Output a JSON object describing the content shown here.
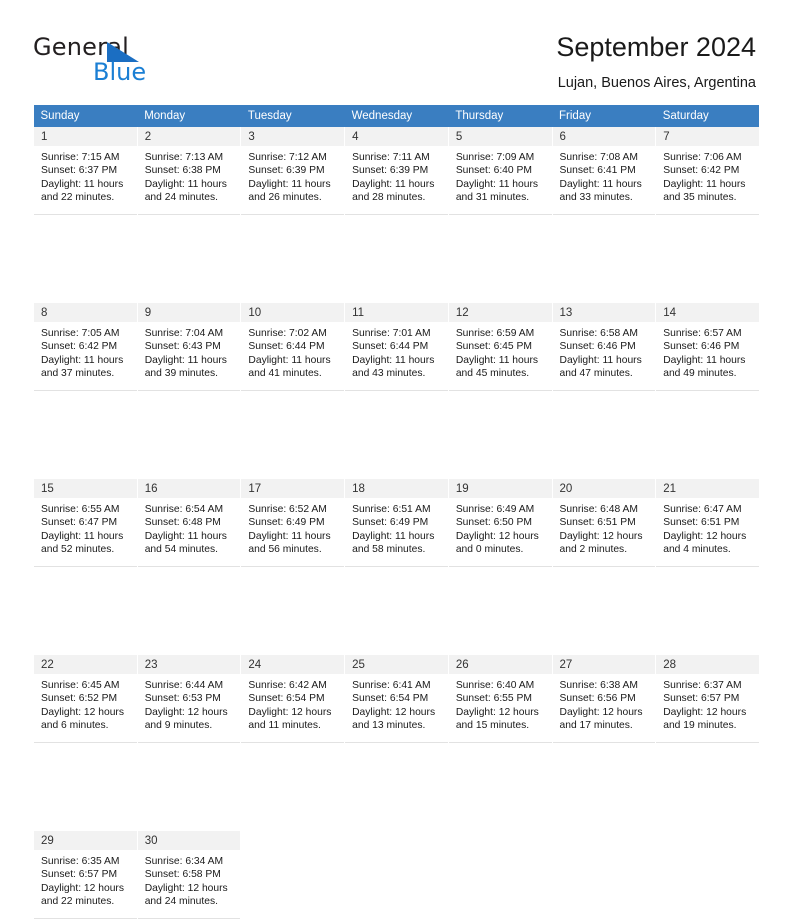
{
  "brand": {
    "name_top": "General",
    "name_bottom": "Blue",
    "accent_color": "#1b7fd4",
    "triangle_color": "#1b6ec2"
  },
  "header": {
    "title": "September 2024",
    "subtitle": "Lujan, Buenos Aires, Argentina",
    "header_bg": "#3a7ec1",
    "header_text_color": "#ffffff"
  },
  "calendar": {
    "weekday_headers": [
      "Sunday",
      "Monday",
      "Tuesday",
      "Wednesday",
      "Thursday",
      "Friday",
      "Saturday"
    ],
    "weeks": [
      [
        {
          "day": "1",
          "sunrise": "Sunrise: 7:15 AM",
          "sunset": "Sunset: 6:37 PM",
          "daylight_line1": "Daylight: 11 hours",
          "daylight_line2": "and 22 minutes."
        },
        {
          "day": "2",
          "sunrise": "Sunrise: 7:13 AM",
          "sunset": "Sunset: 6:38 PM",
          "daylight_line1": "Daylight: 11 hours",
          "daylight_line2": "and 24 minutes."
        },
        {
          "day": "3",
          "sunrise": "Sunrise: 7:12 AM",
          "sunset": "Sunset: 6:39 PM",
          "daylight_line1": "Daylight: 11 hours",
          "daylight_line2": "and 26 minutes."
        },
        {
          "day": "4",
          "sunrise": "Sunrise: 7:11 AM",
          "sunset": "Sunset: 6:39 PM",
          "daylight_line1": "Daylight: 11 hours",
          "daylight_line2": "and 28 minutes."
        },
        {
          "day": "5",
          "sunrise": "Sunrise: 7:09 AM",
          "sunset": "Sunset: 6:40 PM",
          "daylight_line1": "Daylight: 11 hours",
          "daylight_line2": "and 31 minutes."
        },
        {
          "day": "6",
          "sunrise": "Sunrise: 7:08 AM",
          "sunset": "Sunset: 6:41 PM",
          "daylight_line1": "Daylight: 11 hours",
          "daylight_line2": "and 33 minutes."
        },
        {
          "day": "7",
          "sunrise": "Sunrise: 7:06 AM",
          "sunset": "Sunset: 6:42 PM",
          "daylight_line1": "Daylight: 11 hours",
          "daylight_line2": "and 35 minutes."
        }
      ],
      [
        {
          "day": "8",
          "sunrise": "Sunrise: 7:05 AM",
          "sunset": "Sunset: 6:42 PM",
          "daylight_line1": "Daylight: 11 hours",
          "daylight_line2": "and 37 minutes."
        },
        {
          "day": "9",
          "sunrise": "Sunrise: 7:04 AM",
          "sunset": "Sunset: 6:43 PM",
          "daylight_line1": "Daylight: 11 hours",
          "daylight_line2": "and 39 minutes."
        },
        {
          "day": "10",
          "sunrise": "Sunrise: 7:02 AM",
          "sunset": "Sunset: 6:44 PM",
          "daylight_line1": "Daylight: 11 hours",
          "daylight_line2": "and 41 minutes."
        },
        {
          "day": "11",
          "sunrise": "Sunrise: 7:01 AM",
          "sunset": "Sunset: 6:44 PM",
          "daylight_line1": "Daylight: 11 hours",
          "daylight_line2": "and 43 minutes."
        },
        {
          "day": "12",
          "sunrise": "Sunrise: 6:59 AM",
          "sunset": "Sunset: 6:45 PM",
          "daylight_line1": "Daylight: 11 hours",
          "daylight_line2": "and 45 minutes."
        },
        {
          "day": "13",
          "sunrise": "Sunrise: 6:58 AM",
          "sunset": "Sunset: 6:46 PM",
          "daylight_line1": "Daylight: 11 hours",
          "daylight_line2": "and 47 minutes."
        },
        {
          "day": "14",
          "sunrise": "Sunrise: 6:57 AM",
          "sunset": "Sunset: 6:46 PM",
          "daylight_line1": "Daylight: 11 hours",
          "daylight_line2": "and 49 minutes."
        }
      ],
      [
        {
          "day": "15",
          "sunrise": "Sunrise: 6:55 AM",
          "sunset": "Sunset: 6:47 PM",
          "daylight_line1": "Daylight: 11 hours",
          "daylight_line2": "and 52 minutes."
        },
        {
          "day": "16",
          "sunrise": "Sunrise: 6:54 AM",
          "sunset": "Sunset: 6:48 PM",
          "daylight_line1": "Daylight: 11 hours",
          "daylight_line2": "and 54 minutes."
        },
        {
          "day": "17",
          "sunrise": "Sunrise: 6:52 AM",
          "sunset": "Sunset: 6:49 PM",
          "daylight_line1": "Daylight: 11 hours",
          "daylight_line2": "and 56 minutes."
        },
        {
          "day": "18",
          "sunrise": "Sunrise: 6:51 AM",
          "sunset": "Sunset: 6:49 PM",
          "daylight_line1": "Daylight: 11 hours",
          "daylight_line2": "and 58 minutes."
        },
        {
          "day": "19",
          "sunrise": "Sunrise: 6:49 AM",
          "sunset": "Sunset: 6:50 PM",
          "daylight_line1": "Daylight: 12 hours",
          "daylight_line2": "and 0 minutes."
        },
        {
          "day": "20",
          "sunrise": "Sunrise: 6:48 AM",
          "sunset": "Sunset: 6:51 PM",
          "daylight_line1": "Daylight: 12 hours",
          "daylight_line2": "and 2 minutes."
        },
        {
          "day": "21",
          "sunrise": "Sunrise: 6:47 AM",
          "sunset": "Sunset: 6:51 PM",
          "daylight_line1": "Daylight: 12 hours",
          "daylight_line2": "and 4 minutes."
        }
      ],
      [
        {
          "day": "22",
          "sunrise": "Sunrise: 6:45 AM",
          "sunset": "Sunset: 6:52 PM",
          "daylight_line1": "Daylight: 12 hours",
          "daylight_line2": "and 6 minutes."
        },
        {
          "day": "23",
          "sunrise": "Sunrise: 6:44 AM",
          "sunset": "Sunset: 6:53 PM",
          "daylight_line1": "Daylight: 12 hours",
          "daylight_line2": "and 9 minutes."
        },
        {
          "day": "24",
          "sunrise": "Sunrise: 6:42 AM",
          "sunset": "Sunset: 6:54 PM",
          "daylight_line1": "Daylight: 12 hours",
          "daylight_line2": "and 11 minutes."
        },
        {
          "day": "25",
          "sunrise": "Sunrise: 6:41 AM",
          "sunset": "Sunset: 6:54 PM",
          "daylight_line1": "Daylight: 12 hours",
          "daylight_line2": "and 13 minutes."
        },
        {
          "day": "26",
          "sunrise": "Sunrise: 6:40 AM",
          "sunset": "Sunset: 6:55 PM",
          "daylight_line1": "Daylight: 12 hours",
          "daylight_line2": "and 15 minutes."
        },
        {
          "day": "27",
          "sunrise": "Sunrise: 6:38 AM",
          "sunset": "Sunset: 6:56 PM",
          "daylight_line1": "Daylight: 12 hours",
          "daylight_line2": "and 17 minutes."
        },
        {
          "day": "28",
          "sunrise": "Sunrise: 6:37 AM",
          "sunset": "Sunset: 6:57 PM",
          "daylight_line1": "Daylight: 12 hours",
          "daylight_line2": "and 19 minutes."
        }
      ],
      [
        {
          "day": "29",
          "sunrise": "Sunrise: 6:35 AM",
          "sunset": "Sunset: 6:57 PM",
          "daylight_line1": "Daylight: 12 hours",
          "daylight_line2": "and 22 minutes."
        },
        {
          "day": "30",
          "sunrise": "Sunrise: 6:34 AM",
          "sunset": "Sunset: 6:58 PM",
          "daylight_line1": "Daylight: 12 hours",
          "daylight_line2": "and 24 minutes."
        },
        {
          "day": "",
          "sunrise": "",
          "sunset": "",
          "daylight_line1": "",
          "daylight_line2": ""
        },
        {
          "day": "",
          "sunrise": "",
          "sunset": "",
          "daylight_line1": "",
          "daylight_line2": ""
        },
        {
          "day": "",
          "sunrise": "",
          "sunset": "",
          "daylight_line1": "",
          "daylight_line2": ""
        },
        {
          "day": "",
          "sunrise": "",
          "sunset": "",
          "daylight_line1": "",
          "daylight_line2": ""
        },
        {
          "day": "",
          "sunrise": "",
          "sunset": "",
          "daylight_line1": "",
          "daylight_line2": ""
        }
      ]
    ]
  }
}
